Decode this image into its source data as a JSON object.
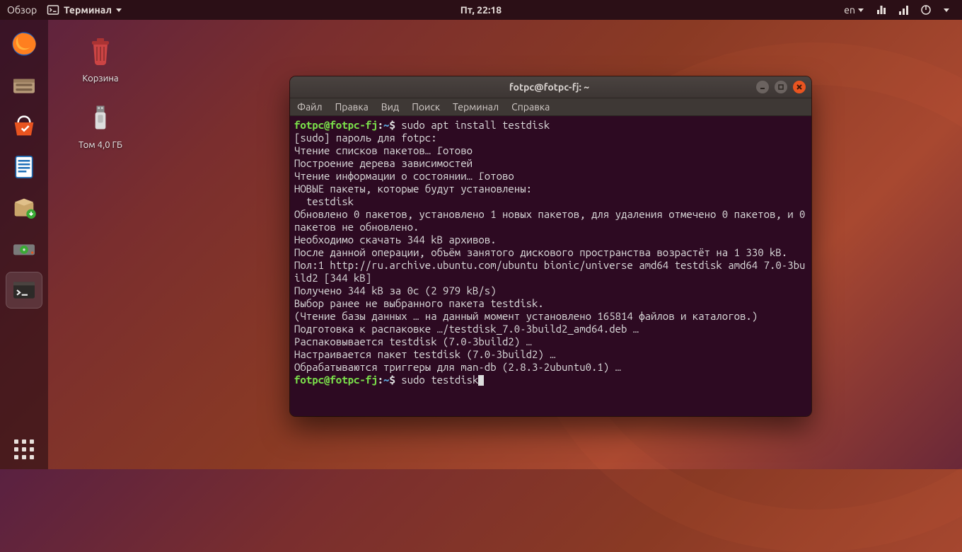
{
  "topbar": {
    "activities": "Обзор",
    "app_label": "Терминал",
    "clock": "Пт, 22:18",
    "lang": "en"
  },
  "dock": {
    "active_index": 6
  },
  "desktop": {
    "trash_label": "Корзина",
    "usb_label": "Том 4,0 ГБ"
  },
  "terminal": {
    "title": "fotpc@fotpc-fj: ~",
    "menu": {
      "file": "Файл",
      "edit": "Правка",
      "view": "Вид",
      "search": "Поиск",
      "terminal": "Терминал",
      "help": "Справка"
    },
    "prompt_user": "fotpc@fotpc-fj",
    "prompt_path": "~",
    "prompt_sep": ":",
    "prompt_end": "$ ",
    "cmd1": "sudo apt install testdisk",
    "output": "[sudo] пароль для fotpc:\nЧтение списков пакетов… Готово\nПостроение дерева зависимостей\nЧтение информации о состоянии… Готово\nНОВЫЕ пакеты, которые будут установлены:\n  testdisk\nОбновлено 0 пакетов, установлено 1 новых пакетов, для удаления отмечено 0 пакетов, и 0 пакетов не обновлено.\nНеобходимо скачать 344 kB архивов.\nПосле данной операции, объём занятого дискового пространства возрастёт на 1 330 kB.\nПол:1 http://ru.archive.ubuntu.com/ubuntu bionic/universe amd64 testdisk amd64 7.0-3build2 [344 kB]\nПолучено 344 kB за 0с (2 979 kB/s)\nВыбор ранее не выбранного пакета testdisk.\n(Чтение базы данных … на данный момент установлено 165814 файлов и каталогов.)\nПодготовка к распаковке …/testdisk_7.0-3build2_amd64.deb …\nРаспаковывается testdisk (7.0-3build2) …\nНастраивается пакет testdisk (7.0-3build2) …\nОбрабатываются триггеры для man-db (2.8.3-2ubuntu0.1) …",
    "cmd2": "sudo testdisk"
  }
}
